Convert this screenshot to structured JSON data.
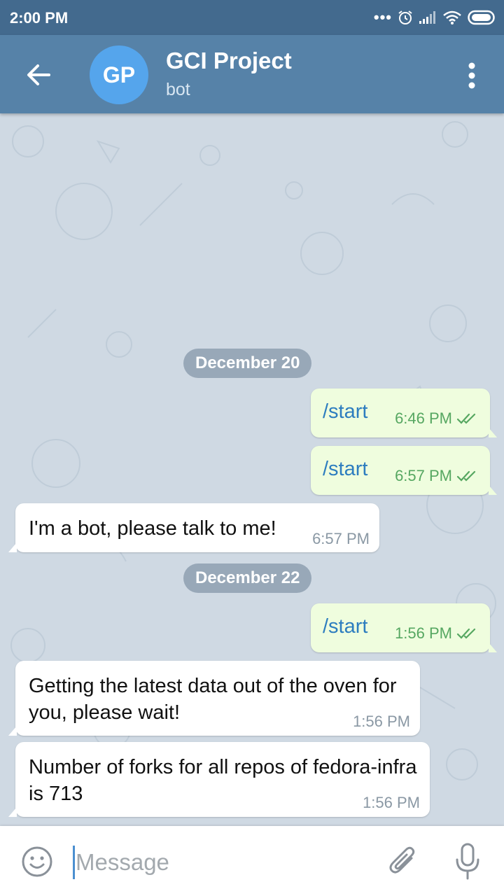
{
  "status_bar": {
    "time": "2:00 PM"
  },
  "header": {
    "avatar_initials": "GP",
    "title": "GCI Project",
    "subtitle": "bot"
  },
  "messages": [
    {
      "type": "date",
      "text": "December 20"
    },
    {
      "type": "outgoing",
      "text": "/start",
      "time": "6:46 PM",
      "status": "read"
    },
    {
      "type": "outgoing",
      "text": "/start",
      "time": "6:57 PM",
      "status": "read"
    },
    {
      "type": "incoming",
      "text": "I'm a bot, please talk to me!",
      "time": "6:57 PM"
    },
    {
      "type": "date",
      "text": "December 22"
    },
    {
      "type": "outgoing",
      "text": "/start",
      "time": "1:56 PM",
      "status": "read"
    },
    {
      "type": "incoming",
      "text": "Getting the latest data out of the oven for you, please wait!",
      "time": "1:56 PM"
    },
    {
      "type": "incoming",
      "text": "Number of forks for all repos of fedora-infra is 713",
      "time": "1:56 PM"
    }
  ],
  "input": {
    "placeholder": "Message",
    "value": ""
  },
  "icons": {
    "back": "arrow-left-icon",
    "menu": "more-vertical-icon",
    "emoji": "smile-icon",
    "attach": "paperclip-icon",
    "mic": "microphone-icon",
    "read_receipt": "double-check-icon"
  },
  "colors": {
    "status_bar": "#436a8e",
    "header": "#5682a8",
    "avatar": "#55a5ec",
    "chat_background": "#cfd9e3",
    "outgoing_bubble": "#effdde",
    "incoming_bubble": "#ffffff",
    "command_link": "#2d7dbf",
    "outgoing_meta": "#56a761"
  }
}
